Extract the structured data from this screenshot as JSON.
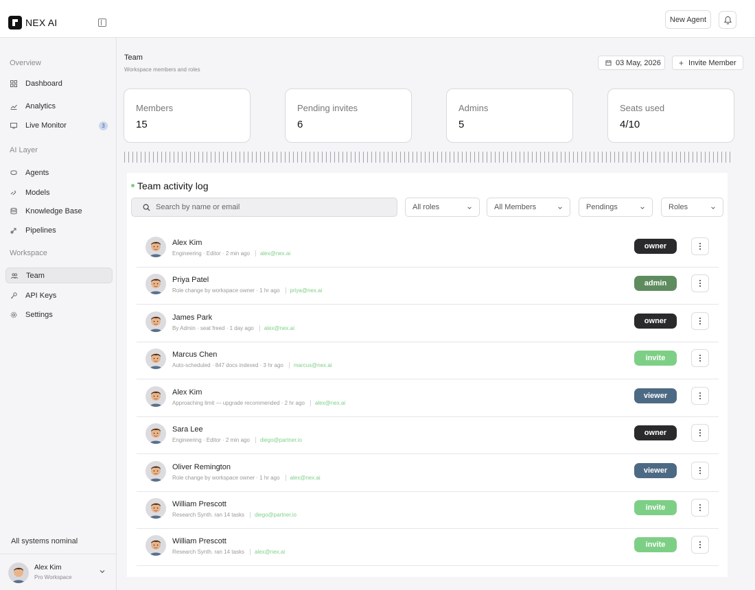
{
  "app": {
    "brand": "NEX AI",
    "new_agent_label": "New Agent"
  },
  "sidebar": {
    "sections": [
      {
        "label": "Overview"
      },
      {
        "label": "AI Layer"
      },
      {
        "label": "Workspace"
      }
    ],
    "items": [
      {
        "label": "Dashboard",
        "icon": "dashboard-icon"
      },
      {
        "label": "Analytics",
        "icon": "chart-icon"
      },
      {
        "label": "Live Monitor",
        "icon": "monitor-icon",
        "badge": "3"
      },
      {
        "label": "Agents",
        "icon": "agent-icon"
      },
      {
        "label": "Models",
        "icon": "models-icon"
      },
      {
        "label": "Knowledge Base",
        "icon": "database-icon"
      },
      {
        "label": "Pipelines",
        "icon": "pipeline-icon"
      },
      {
        "label": "Team",
        "icon": "team-icon",
        "active": true
      },
      {
        "label": "API Keys",
        "icon": "key-icon"
      },
      {
        "label": "Settings",
        "icon": "gear-icon"
      }
    ],
    "status": "All systems nominal",
    "user": {
      "name": "Alex Kim",
      "plan": "Pro Workspace"
    }
  },
  "header": {
    "title": "Team",
    "subtitle": "Workspace members and roles",
    "date": "03 May, 2026",
    "invite_label": "Invite Member"
  },
  "stats": [
    {
      "label": "Members",
      "value": "15"
    },
    {
      "label": "Pending invites",
      "value": "6"
    },
    {
      "label": "Admins",
      "value": "5"
    },
    {
      "label": "Seats used",
      "value": "4/10"
    }
  ],
  "activity": {
    "title": "Team activity log",
    "search_placeholder": "Search by name or email",
    "filters": [
      "All roles",
      "All Members",
      "Pendings",
      "Roles"
    ],
    "rows": [
      {
        "name": "Alex Kim",
        "meta": "Engineering · Editor · 2 min ago",
        "email": "alex@nex.ai",
        "role": "owner"
      },
      {
        "name": "Priya Patel",
        "meta": "Role change by workspace owner · 1 hr ago",
        "email": "priya@nex.ai",
        "role": "admin"
      },
      {
        "name": "James Park",
        "meta": "By Admin · seat freed · 1 day ago",
        "email": "alex@nex.ai",
        "role": "owner"
      },
      {
        "name": "Marcus Chen",
        "meta": "Auto-scheduled · 847 docs indexed · 3 hr ago",
        "email": "marcus@nex.ai",
        "role": "invite"
      },
      {
        "name": "Alex Kim",
        "meta": "Approaching limit — upgrade recommended · 2 hr ago",
        "email": "alex@nex.ai",
        "role": "viewer"
      },
      {
        "name": "Sara Lee",
        "meta": "Engineering · Editor · 2 min ago",
        "email": "diego@partner.io",
        "role": "owner"
      },
      {
        "name": "Oliver Remington",
        "meta": "Role change by workspace owner · 1 hr ago",
        "email": "alex@nex.ai",
        "role": "viewer"
      },
      {
        "name": "William Prescott",
        "meta": "Research Synth. ran 14 tasks",
        "email": "diego@partner.io",
        "role": "invite"
      },
      {
        "name": "William Prescott",
        "meta": "Research Synth. ran 14 tasks",
        "email": "alex@nex.ai",
        "role": "invite"
      }
    ]
  },
  "colors": {
    "owner": "#2a2a2c",
    "admin": "#5e8c5f",
    "invite": "#7ecf86",
    "viewer": "#4d6a85",
    "accent_green": "#7ecf86"
  }
}
